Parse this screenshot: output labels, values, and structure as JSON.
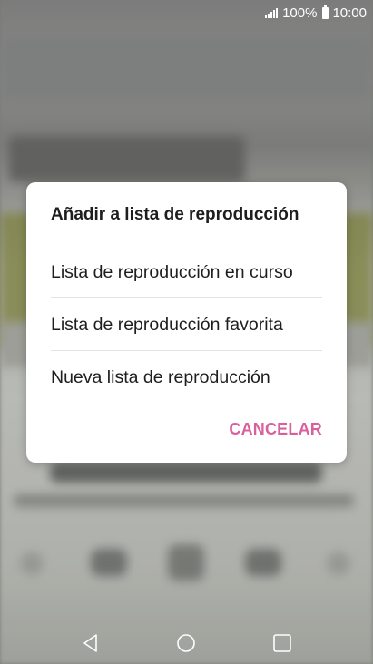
{
  "status_bar": {
    "battery_percent": "100%",
    "time": "10:00",
    "icons": [
      "signal-icon",
      "battery-icon"
    ]
  },
  "dialog": {
    "title": "Añadir a lista de reproducción",
    "options": [
      {
        "label": "Lista de reproducción en curso"
      },
      {
        "label": "Lista de reproducción favorita"
      },
      {
        "label": "Nueva lista de reproducción"
      }
    ],
    "cancel_label": "CANCELAR",
    "accent_color": "#d9609c"
  },
  "nav_bar": {
    "icons": [
      "back-icon",
      "home-icon",
      "recent-apps-icon"
    ]
  }
}
